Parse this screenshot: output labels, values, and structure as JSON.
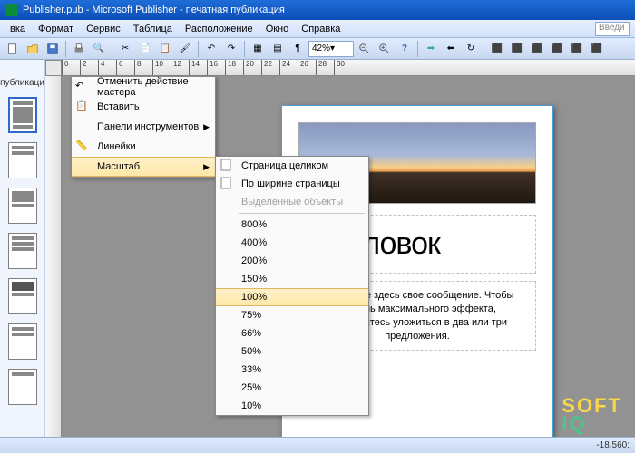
{
  "title": "Publisher.pub - Microsoft Publisher - печатная публикация",
  "menubar": [
    "вка",
    "Формат",
    "Сервис",
    "Таблица",
    "Расположение",
    "Окно",
    "Справка"
  ],
  "zoom": "42%",
  "type_prompt": "Введи",
  "context_menu": [
    {
      "label": "Отменить действие мастера",
      "icon": "undo"
    },
    {
      "label": "Вставить",
      "icon": "paste"
    },
    {
      "label": "Панели инструментов",
      "arrow": true
    },
    {
      "label": "Линейки",
      "icon": "ruler"
    },
    {
      "label": "Масштаб",
      "arrow": true,
      "hl": true
    }
  ],
  "submenu": [
    {
      "label": "Страница целиком",
      "icon": "page"
    },
    {
      "label": "По ширине страницы",
      "icon": "width"
    },
    {
      "label": "Выделенные объекты",
      "disabled": true
    },
    {
      "sep": true
    },
    {
      "label": "800%"
    },
    {
      "label": "400%"
    },
    {
      "label": "200%"
    },
    {
      "label": "150%"
    },
    {
      "label": "100%",
      "hl": true
    },
    {
      "label": "75%"
    },
    {
      "label": "66%"
    },
    {
      "label": "50%"
    },
    {
      "label": "33%"
    },
    {
      "label": "25%"
    },
    {
      "label": "10%"
    }
  ],
  "page": {
    "title": "Заголовок",
    "body": "Поместите здесь свое сообщение. Чтобы достичь максимального эффекта, постарайтесь уложиться в два или три предложения."
  },
  "status": "-18,560;",
  "sidebar_label": "публикаци",
  "ruler_marks": [
    0,
    2,
    4,
    6,
    8,
    10,
    12,
    14,
    16,
    18,
    20,
    22,
    24,
    26,
    28,
    30
  ],
  "watermark": {
    "l1": "SOFT",
    "l2": "IQ"
  }
}
